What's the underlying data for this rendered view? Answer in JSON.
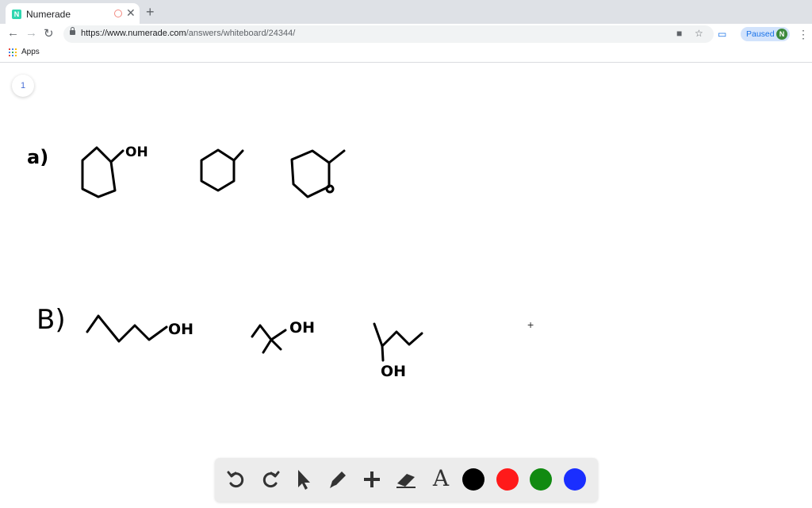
{
  "browser": {
    "tab_title": "Numerade",
    "favicon_letter": "N",
    "url_host": "https://www.numerade.com",
    "url_path": "/answers/whiteboard/24344/",
    "profile_status": "Paused",
    "profile_initial": "N",
    "bookmarks": {
      "apps_label": "Apps"
    }
  },
  "whiteboard": {
    "page_number": "1",
    "labels": {
      "part_a": "a)",
      "part_b": "B)",
      "oh_1": "OH",
      "oh_2": "OH",
      "oh_3": "OH",
      "oh_4": "OH"
    }
  },
  "toolbar": {
    "tools": [
      "undo-icon",
      "redo-icon",
      "pointer-icon",
      "pen-icon",
      "plus-icon",
      "eraser-icon",
      "text-icon"
    ],
    "text_tool_glyph": "A",
    "colors": [
      "#000000",
      "#ff1a1a",
      "#118a11",
      "#1a2eff"
    ]
  }
}
